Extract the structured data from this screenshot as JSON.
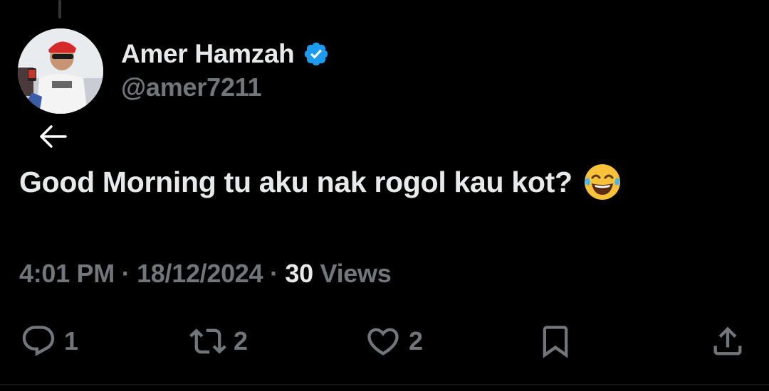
{
  "tweet": {
    "author": {
      "display_name": "Amer Hamzah",
      "handle": "@amer7211",
      "verified": true,
      "avatar_icon": "profile-photo"
    },
    "text": "Good Morning tu aku nak rogol kau kot?",
    "emoji": "😂",
    "time": "4:01 PM",
    "separator": "·",
    "date": "18/12/2024",
    "views_count": "30",
    "views_label": "Views"
  },
  "actions": {
    "reply_count": "1",
    "retweet_count": "2",
    "like_count": "2"
  },
  "icons": {
    "back": "arrow-left-icon",
    "verified": "verified-badge-icon",
    "reply": "reply-icon",
    "retweet": "retweet-icon",
    "like": "heart-icon",
    "bookmark": "bookmark-icon",
    "share": "share-icon"
  },
  "colors": {
    "background": "#000000",
    "primary_text": "#e7e9ea",
    "secondary_text": "#71767b",
    "verified_blue": "#1d9bf0"
  }
}
